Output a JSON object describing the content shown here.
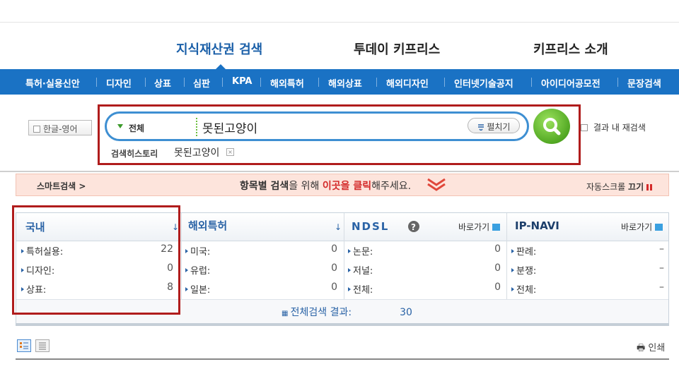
{
  "top_nav": [
    "지식재산권 검색",
    "투데이 키프리스",
    "키프리스 소개"
  ],
  "menu": [
    "특허·실용신안",
    "디자인",
    "상표",
    "심판",
    "KPA",
    "해외특허",
    "해외상표",
    "해외디자인",
    "인터넷기술공지",
    "아이디어공모전",
    "문장검색"
  ],
  "search": {
    "hangul_toggle": "한글-영어",
    "scope": "전체",
    "query": "못된고양이",
    "fold_label": "펼치기",
    "research_label": "결과 내 재검색",
    "history_label": "검색히스토리",
    "history_item": "못된고양이"
  },
  "smart": {
    "left": "스마트검색 >",
    "center_a": "항목별 검색",
    "center_b": "을 위해 ",
    "center_c": "이곳을 클릭",
    "center_d": "해주세요.",
    "auto_scroll": "자동스크롤",
    "off": "끄기"
  },
  "results": {
    "domestic": {
      "title": "국내",
      "rows": [
        {
          "label": "특허실용:",
          "value": "22"
        },
        {
          "label": "디자인:",
          "value": "0"
        },
        {
          "label": "상표:",
          "value": "8"
        }
      ]
    },
    "overseas": {
      "title": "해외특허",
      "rows": [
        {
          "label": "미국:",
          "value": "0"
        },
        {
          "label": "유럽:",
          "value": "0"
        },
        {
          "label": "일본:",
          "value": "0"
        }
      ]
    },
    "ndsl": {
      "title": "NDSL",
      "goto": "바로가기",
      "rows": [
        {
          "label": "논문:",
          "value": "0"
        },
        {
          "label": "저널:",
          "value": "0"
        },
        {
          "label": "전체:",
          "value": "0"
        }
      ]
    },
    "ipnavi": {
      "title": "IP-NAVI",
      "goto": "바로가기",
      "rows": [
        {
          "label": "판례:",
          "value": "–"
        },
        {
          "label": "분쟁:",
          "value": "–"
        },
        {
          "label": "전체:",
          "value": "–"
        }
      ]
    },
    "total_label": "전체검색 결과:",
    "total_count": "30"
  },
  "print_label": "인쇄",
  "colors": {
    "menu_blue": "#1a72c4",
    "highlight_red": "#b01c1c",
    "search_green": "#52a823"
  }
}
